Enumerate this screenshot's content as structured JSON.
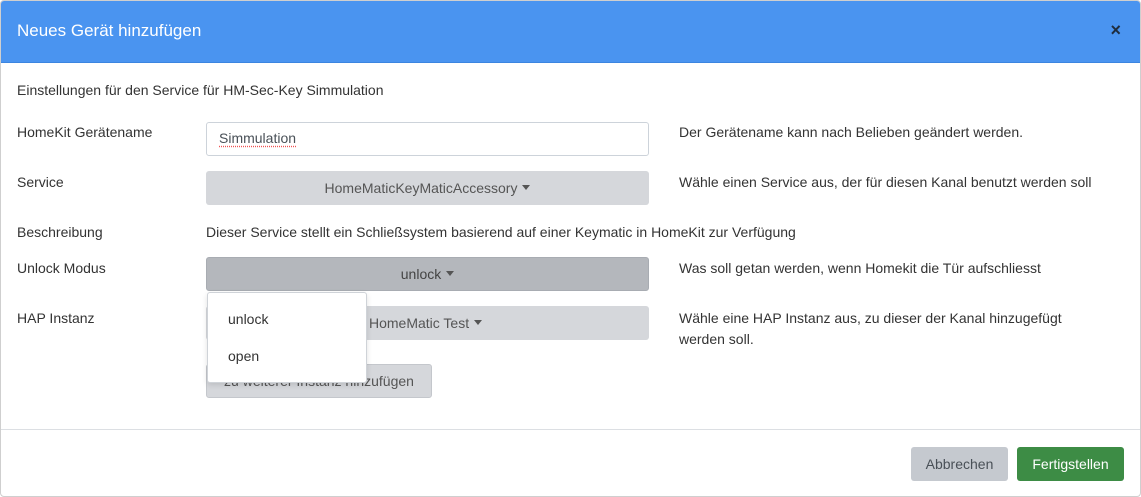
{
  "modal": {
    "title": "Neues Gerät hinzufügen",
    "close_symbol": "×",
    "intro": "Einstellungen für den Service für HM-Sec-Key Simmulation"
  },
  "form": {
    "name_label": "HomeKit Gerätename",
    "name_value": "Simmulation",
    "name_help": "Der Gerätename kann nach Belieben geändert werden.",
    "service_label": "Service",
    "service_value": "HomeMaticKeyMaticAccessory",
    "service_help": "Wähle einen Service aus, der für diesen Kanal benutzt werden soll",
    "description_label": "Beschreibung",
    "description_value": "Dieser Service stellt ein Schließsystem basierend auf einer Keymatic in HomeKit zur Verfügung",
    "unlock_label": "Unlock Modus",
    "unlock_value": "unlock",
    "unlock_help": "Was soll getan werden, wenn Homekit die Tür aufschliesst",
    "unlock_options": [
      "unlock",
      "open"
    ],
    "hap_label": "HAP Instanz",
    "hap_value": "HomeMatic Test",
    "hap_help_line1": "Wähle eine HAP Instanz aus, zu dieser der Kanal hinzugefügt",
    "hap_help_line2": "werden soll.",
    "add_instance_label": "zu weiterer Instanz hinzufügen"
  },
  "footer": {
    "cancel_label": "Abbrechen",
    "finish_label": "Fertigstellen"
  },
  "colors": {
    "header": "#4a94f0",
    "finish_button": "#3d8c45",
    "select_button": "#d5d7db"
  }
}
